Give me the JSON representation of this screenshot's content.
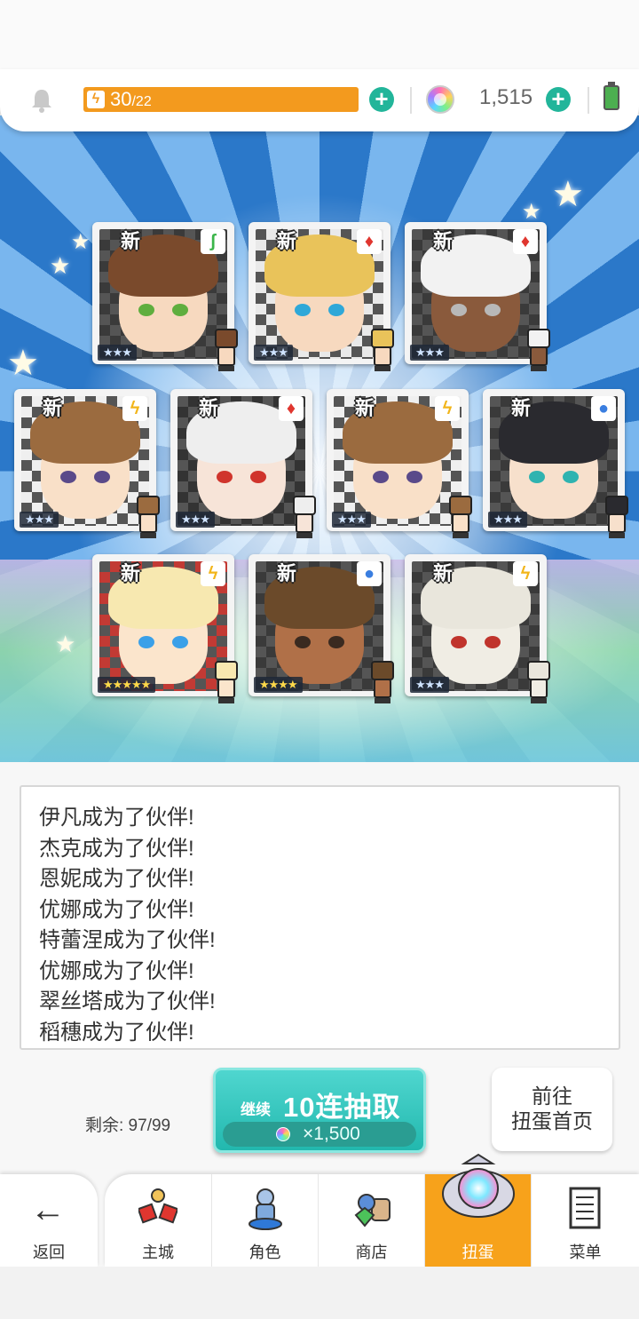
{
  "topbar": {
    "stamina_current": "30",
    "stamina_max": "/22",
    "gem_count": "1,515",
    "icons": [
      "bell-icon",
      "bolt-icon",
      "plus-icon",
      "gem-icon",
      "battery-icon"
    ]
  },
  "cards": [
    {
      "new": "新",
      "stars": "★★★",
      "attr": "leaf"
    },
    {
      "new": "新",
      "stars": "★★★",
      "attr": "fire"
    },
    {
      "new": "新",
      "stars": "★★★",
      "attr": "fire"
    },
    {
      "new": "新",
      "stars": "★★★",
      "attr": "thunder"
    },
    {
      "new": "新",
      "stars": "★★★",
      "attr": "fire"
    },
    {
      "new": "新",
      "stars": "★★★",
      "attr": "thunder"
    },
    {
      "new": "新",
      "stars": "★★★",
      "attr": "water"
    },
    {
      "new": "新",
      "stars": "★★★★★",
      "attr": "thunder"
    },
    {
      "new": "新",
      "stars": "★★★★",
      "attr": "water"
    },
    {
      "new": "新",
      "stars": "★★★",
      "attr": "thunder"
    }
  ],
  "log": [
    "伊凡成为了伙伴!",
    "杰克成为了伙伴!",
    "恩妮成为了伙伴!",
    "优娜成为了伙伴!",
    "特蕾涅成为了伙伴!",
    "优娜成为了伙伴!",
    "翠丝塔成为了伙伴!",
    "稻穗成为了伙伴!"
  ],
  "controls": {
    "remaining": "剩余: 97/99",
    "continue_small": "继续",
    "continue_big": "10连抽取",
    "continue_cost": "×1,500",
    "home_line1": "前往",
    "home_line2": "扭蛋首页"
  },
  "nav": {
    "back": "返回",
    "tabs": [
      "主城",
      "角色",
      "商店",
      "扭蛋",
      "菜单"
    ],
    "active": "扭蛋"
  },
  "colors": {
    "accent": "#f7a21b",
    "teal": "#22b59a",
    "stamina": "#f39a1e"
  }
}
